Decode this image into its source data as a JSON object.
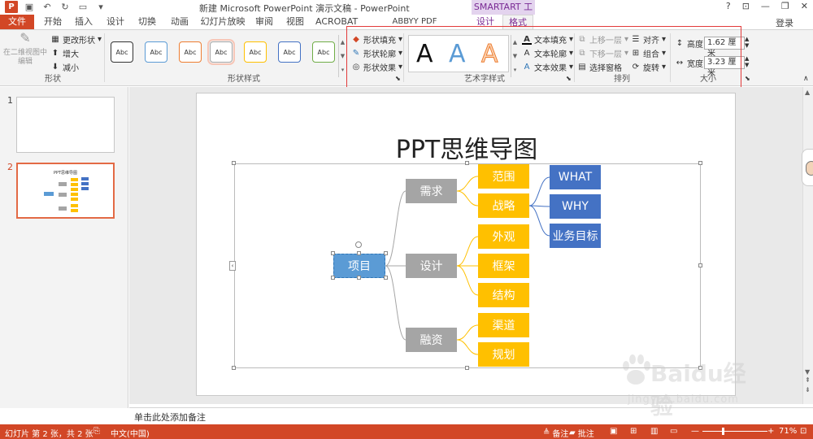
{
  "titlebar": {
    "app_icon": "P",
    "title": "新建 Microsoft PowerPoint 演示文稿 - PowerPoint",
    "contextual_tools": "SMARTART 工具",
    "win_controls": [
      "?",
      "⊡",
      "—",
      "❐",
      "✕"
    ]
  },
  "tabs": {
    "file": "文件",
    "items": [
      "开始",
      "插入",
      "设计",
      "切换",
      "动画",
      "幻灯片放映",
      "审阅",
      "视图",
      "ACROBAT",
      "ABBYY PDF Transformer+",
      "设计",
      "格式"
    ],
    "active": "格式",
    "login": "登录"
  },
  "ribbon": {
    "shapes_group": {
      "label": "形状",
      "edit_2d": "在二维视图中编辑",
      "change_shape": "更改形状",
      "larger": "增大",
      "smaller": "减小"
    },
    "shape_styles": {
      "label": "形状样式",
      "sample": "Abc",
      "swatches": [
        "#333333",
        "#5b9bd5",
        "#ed7d31",
        "#a5a5a5",
        "#ffc000",
        "#4472c4",
        "#70ad47"
      ],
      "fill": "形状填充",
      "outline": "形状轮廓",
      "effects": "形状效果"
    },
    "wordart": {
      "label": "艺术字样式",
      "samples": [
        "A",
        "A",
        "A"
      ],
      "text_fill": "文本填充",
      "text_outline": "文本轮廓",
      "text_effects": "文本效果"
    },
    "arrange": {
      "label": "排列",
      "bring_forward": "上移一层",
      "send_backward": "下移一层",
      "selection_pane": "选择窗格",
      "align": "对齐",
      "group": "组合",
      "rotate": "旋转"
    },
    "size": {
      "label": "大小",
      "height_label": "高度:",
      "height_value": "1.62 厘米",
      "width_label": "宽度:",
      "width_value": "3.23 厘米"
    }
  },
  "thumbnails": [
    {
      "number": "1"
    },
    {
      "number": "2",
      "mini_title": "PPT思维导图"
    }
  ],
  "slide": {
    "title": "PPT思维导图",
    "mindmap": {
      "root": "项目",
      "level1": [
        "需求",
        "设计",
        "融资"
      ],
      "level2": [
        "范围",
        "战略",
        "外观",
        "框架",
        "结构",
        "渠道",
        "规划"
      ],
      "level3": [
        "WHAT",
        "WHY",
        "业务目标"
      ]
    }
  },
  "notes": {
    "placeholder": "单击此处添加备注"
  },
  "status": {
    "slide_info": "幻灯片 第 2 张，共 2 张",
    "language": "中文(中国)",
    "notes": "备注",
    "comments": "批注",
    "zoom": "71%"
  },
  "watermark": {
    "brand": "Baidu经验",
    "url": "jingyan.baidu.com"
  }
}
